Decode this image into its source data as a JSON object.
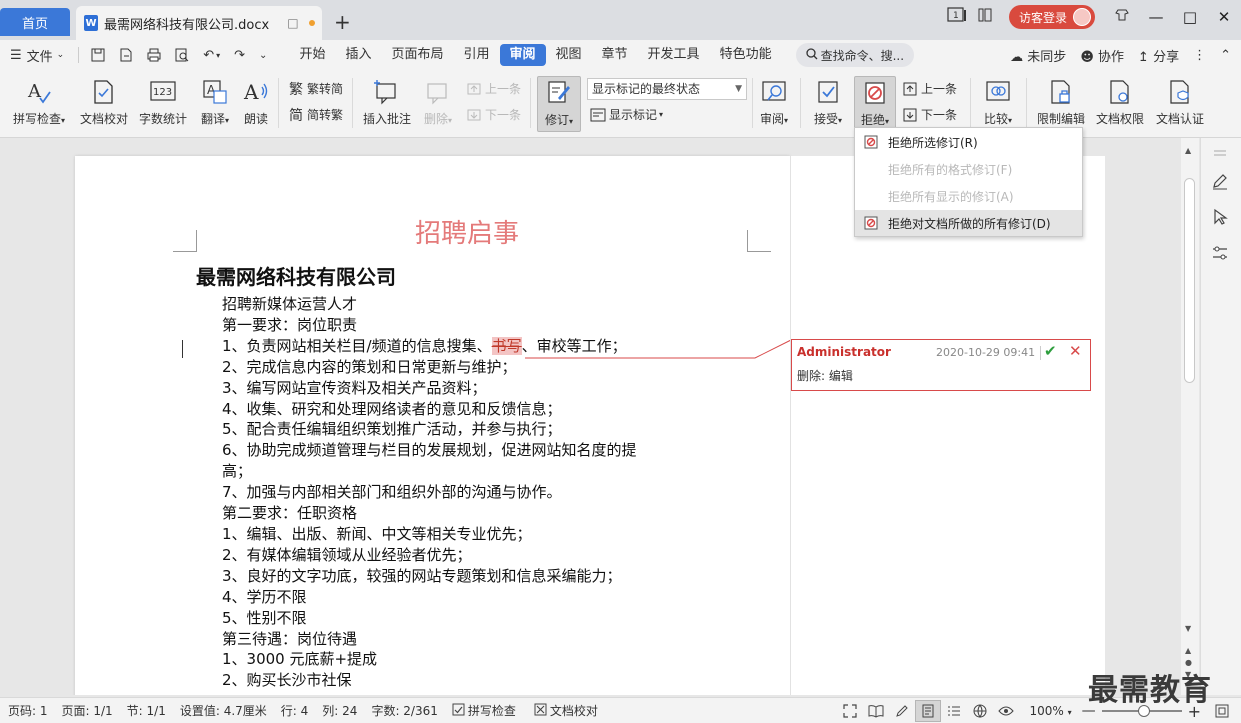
{
  "titlebar": {
    "home_tab": "首页",
    "doc_tab": "最需网络科技有限公司.docx",
    "doc_icon": "W",
    "visitor_login": "访客登录",
    "add_tab": "+"
  },
  "menubar": {
    "file": "文件",
    "tabs": [
      "开始",
      "插入",
      "页面布局",
      "引用",
      "审阅",
      "视图",
      "章节",
      "开发工具",
      "特色功能"
    ],
    "active_tab": "审阅",
    "search": "查找命令、搜...",
    "sync": "未同步",
    "collab": "协作",
    "share": "分享"
  },
  "ribbon": {
    "spell_check": "拼写检查",
    "doc_proof": "文档校对",
    "word_count": "字数统计",
    "translate": "翻译",
    "read_aloud": "朗读",
    "trad_to_simp": "繁转简",
    "simp_to_trad": "简转繁",
    "insert_comment": "插入批注",
    "delete": "删除",
    "prev_comment": "上一条",
    "next_comment": "下一条",
    "track_changes": "修订",
    "markup_state": "显示标记的最终状态",
    "show_markup": "显示标记",
    "review": "审阅",
    "accept": "接受",
    "reject": "拒绝",
    "prev_change": "上一条",
    "next_change": "下一条",
    "compare": "比较",
    "restrict_edit": "限制编辑",
    "doc_permission": "文档权限",
    "doc_cert": "文档认证",
    "count_icon_text": "123"
  },
  "dropdown": {
    "items": [
      {
        "label": "拒绝所选修订(R)",
        "enabled": true
      },
      {
        "label": "拒绝所有的格式修订(F)",
        "enabled": false
      },
      {
        "label": "拒绝所有显示的修订(A)",
        "enabled": false
      },
      {
        "label": "拒绝对文档所做的所有修订(D)",
        "enabled": true
      }
    ]
  },
  "document": {
    "title": "招聘启事",
    "company": "最需网络科技有限公司",
    "line1_before": "1、负责网站相关栏目/频道的信息搜集、",
    "line1_deleted": "书写",
    "line1_after": "、审校等工作；",
    "lines_a": [
      "招聘新媒体运营人才",
      "第一要求：岗位职责"
    ],
    "lines_b": [
      "2、完成信息内容的策划和日常更新与维护；",
      "3、编写网站宣传资料及相关产品资料；",
      "4、收集、研究和处理网络读者的意见和反馈信息；",
      "5、配合责任编辑组织策划推广活动，并参与执行；",
      "6、协助完成频道管理与栏目的发展规划，促进网站知名度的提",
      "高；",
      "7、加强与内部相关部门和组织外部的沟通与协作。",
      "第二要求：任职资格",
      "1、编辑、出版、新闻、中文等相关专业优先；",
      "2、有媒体编辑领域从业经验者优先；",
      "3、良好的文字功底，较强的网站专题策划和信息采编能力；",
      "4、学历不限",
      "5、性别不限",
      "第三待遇：岗位待遇",
      "1、3000 元底薪+提成",
      "2、购买长沙市社保"
    ]
  },
  "comment": {
    "author": "Administrator",
    "time": "2020-10-29 09:41",
    "body": "删除: 编辑"
  },
  "statusbar": {
    "page_num": "页码: 1",
    "pages": "页面: 1/1",
    "section": "节: 1/1",
    "setting": "设置值: 4.7厘米",
    "row": "行: 4",
    "col": "列: 24",
    "words": "字数: 2/361",
    "spell": "拼写检查",
    "proof": "文档校对",
    "zoom": "100%"
  },
  "watermark": "最需教育",
  "colors": {
    "accent": "#3b78d8",
    "deleted": "#c0392b",
    "comment_border": "#d84a4a",
    "title": "#e47a7a"
  }
}
